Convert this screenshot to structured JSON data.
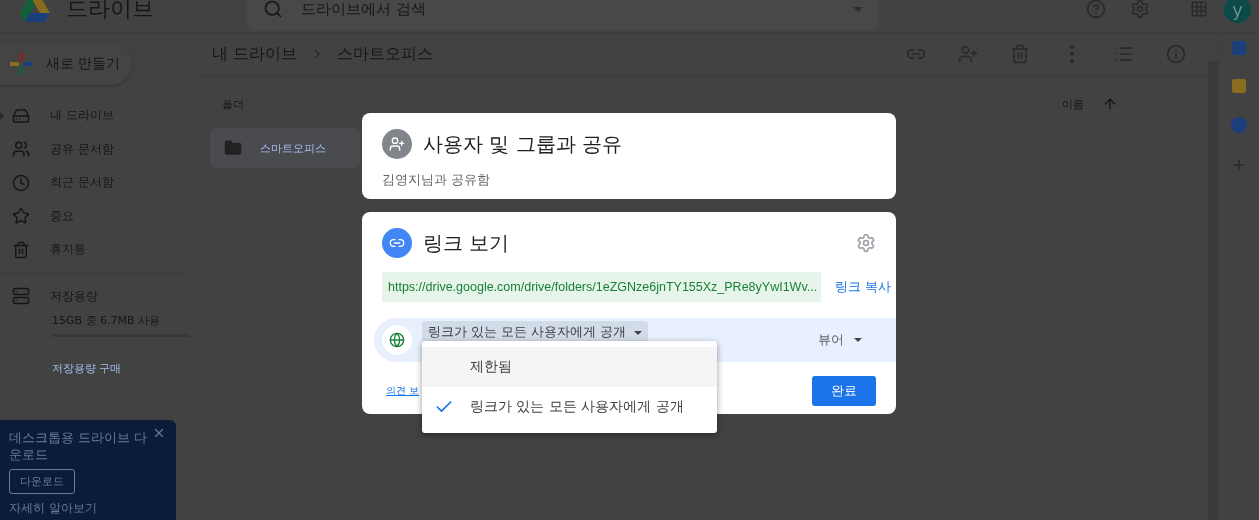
{
  "header": {
    "app_name": "드라이브",
    "search": {
      "placeholder": "드라이브에서 검색"
    },
    "avatar": "y"
  },
  "new_button": {
    "label": "새로 만들기"
  },
  "sidebar": {
    "items": [
      {
        "kind": "drive",
        "label": "내 드라이브",
        "expandable": true
      },
      {
        "kind": "shared",
        "label": "공유 문서함",
        "expandable": false
      },
      {
        "kind": "recent",
        "label": "최근 문서함",
        "expandable": false
      },
      {
        "kind": "starred",
        "label": "중요",
        "expandable": false
      },
      {
        "kind": "trash",
        "label": "휴지통",
        "expandable": false
      }
    ],
    "storage": {
      "label": "저장용량",
      "usage": "15GB 중 6.7MB 사용",
      "level": 0.01,
      "buy_link": "저장용량 구매"
    }
  },
  "breadcrumb": [
    "내 드라이브",
    "스마트오피스"
  ],
  "files": {
    "section": "폴더",
    "sort": "이름",
    "folders": [
      {
        "name": "스마트오피스"
      }
    ]
  },
  "promo": {
    "title": "데스크톱용 드라이브 다운로드",
    "button": "다운로드",
    "link": "자세히 알아보기"
  },
  "share_dialog": {
    "people": {
      "title": "사용자 및 그룹과 공유",
      "subtitle": "김영지님과 공유함"
    },
    "link": {
      "title": "링크 보기",
      "url": "https://drive.google.com/drive/folders/1eZGNze6jnTY155Xz_PRe8yYwI1Wv...",
      "copy": "링크 복사",
      "access": "링크가 있는 모든 사용자에게 공개",
      "role": "뷰어",
      "feedback": "의견 보",
      "done": "완료"
    },
    "access_menu": [
      {
        "label": "제한됨",
        "selected": false
      },
      {
        "label": "링크가 있는 모든 사용자에게 공개",
        "selected": true
      }
    ]
  }
}
